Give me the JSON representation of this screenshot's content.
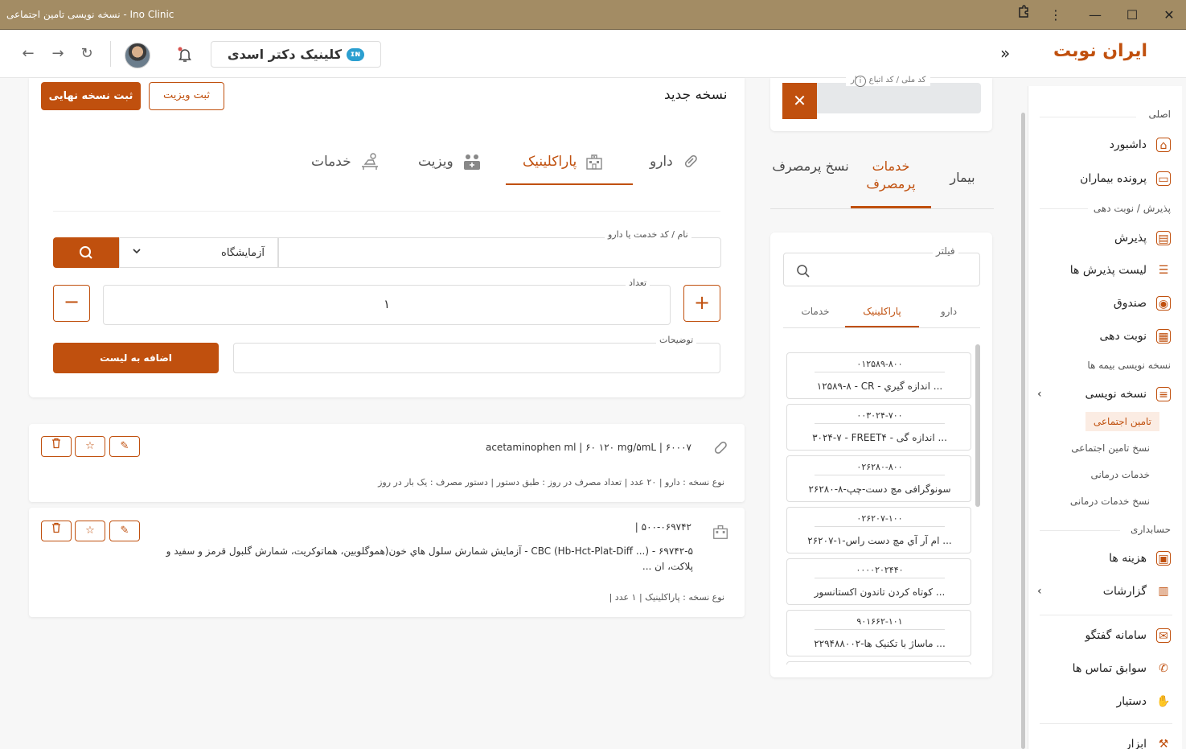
{
  "window": {
    "title": "نسخه نویسی تامین اجتماعی - Ino Clinic"
  },
  "topbar": {
    "clinic_name": "کلینیک دکتر اسدی",
    "brand": "ایران نوبت"
  },
  "sidebar": {
    "section_main": "اصلی",
    "dashboard": "داشبورد",
    "patient_files": "پرونده بیماران",
    "section_reception": "پذیرش / نوبت دهی",
    "reception": "پذیرش",
    "reception_list": "لیست پذیرش ها",
    "cashbox": "صندوق",
    "appointments": "نوبت دهی",
    "section_insurance": "نسخه نویسی بیمه ها",
    "prescribing": "نسخه نویسی",
    "sub_tamin": "تامین اجتماعی",
    "sub_tamin_rx": "نسخ تامین اجتماعی",
    "sub_services": "خدمات درمانی",
    "sub_services_rx": "نسخ خدمات درمانی",
    "section_accounting": "حسابداری",
    "expenses": "هزینه ها",
    "reports": "گزارشات",
    "chat": "سامانه گفتگو",
    "call_history": "سوابق تماس ها",
    "assistant": "دستیار",
    "last_item": "ابزار"
  },
  "patient_panel": {
    "id_label": "کد ملی / کد اتباع بیمار",
    "tabs": {
      "patient": "بیمار",
      "frequent_services": "خدمات پرمصرف",
      "frequent_rx": "نسخ پرمصرف"
    },
    "filter_label": "فیلتر",
    "filter_tabs": {
      "drug": "دارو",
      "paraclinic": "پاراکلینیک",
      "services": "خدمات"
    },
    "items": [
      {
        "code": "۰۱۲۵۸۹-۸۰۰",
        "name": "۱۲۵۸۹-۸ - CR - اندازه گيري ..."
      },
      {
        "code": "۰۰۳۰۲۴-۷۰۰",
        "name": "۳۰۲۴-۷ - FREET۴ - اندازه گی ..."
      },
      {
        "code": "۰۲۶۲۸۰-۸۰۰",
        "name": "۲۶۲۸۰-۸-سونوگرافی مچ دست-چپ"
      },
      {
        "code": "۰۲۶۲۰۷-۱۰۰",
        "name": "۲۶۲۰۷-۱-ام آر آي مچ دست راس ..."
      },
      {
        "code": "۰۰۰۰۲۰۲۴۴۰",
        "name": "کوتاه کردن تاندون اکستانسور ..."
      },
      {
        "code": "۹۰۱۶۶۲-۱۰۱",
        "name": "۲۲۹۴۸۸۰۰۲-ماساژ با تکنیک ها ..."
      }
    ]
  },
  "main": {
    "page_title": "نسخه جدید",
    "btn_final": "ثبت نسخه نهایی",
    "btn_visit": "ثبت ویزیت",
    "tabs": {
      "drug": "دارو",
      "paraclinic": "پاراکلینیک",
      "visit": "ویزیت",
      "services": "خدمات"
    },
    "service_label": "نام / کد خدمت یا دارو",
    "service_type": "آزمایشگاه",
    "qty_label": "تعداد",
    "qty_value": "۱",
    "desc_label": "توضیحات",
    "btn_add": "اضافه به لیست"
  },
  "prescriptions": [
    {
      "line": "۶۰۰۰۷ |  acetaminophen ml   |   ۶۰ ۱۲۰ mg/۵mL",
      "meta": "نوع نسخه : دارو  |  ۲۰ عدد  |  تعداد مصرف در روز : طبق دستور  |  دستور مصرف : یک بار در روز"
    },
    {
      "line": "۵۰۰-۰۶۹۷۴۲ |",
      "desc": "۶۹۷۴۲-۵ - (... CBC (Hb-Hct-Plat-Diff - آزمايش شمارش سلول هاي خون(هموگلوبين، هماتوكريت، شمارش گلبول قرمز و سفيد و پلاكت، ان ...",
      "meta": "نوع نسخه : پاراکلینیک  |  ۱ عدد  |"
    }
  ]
}
